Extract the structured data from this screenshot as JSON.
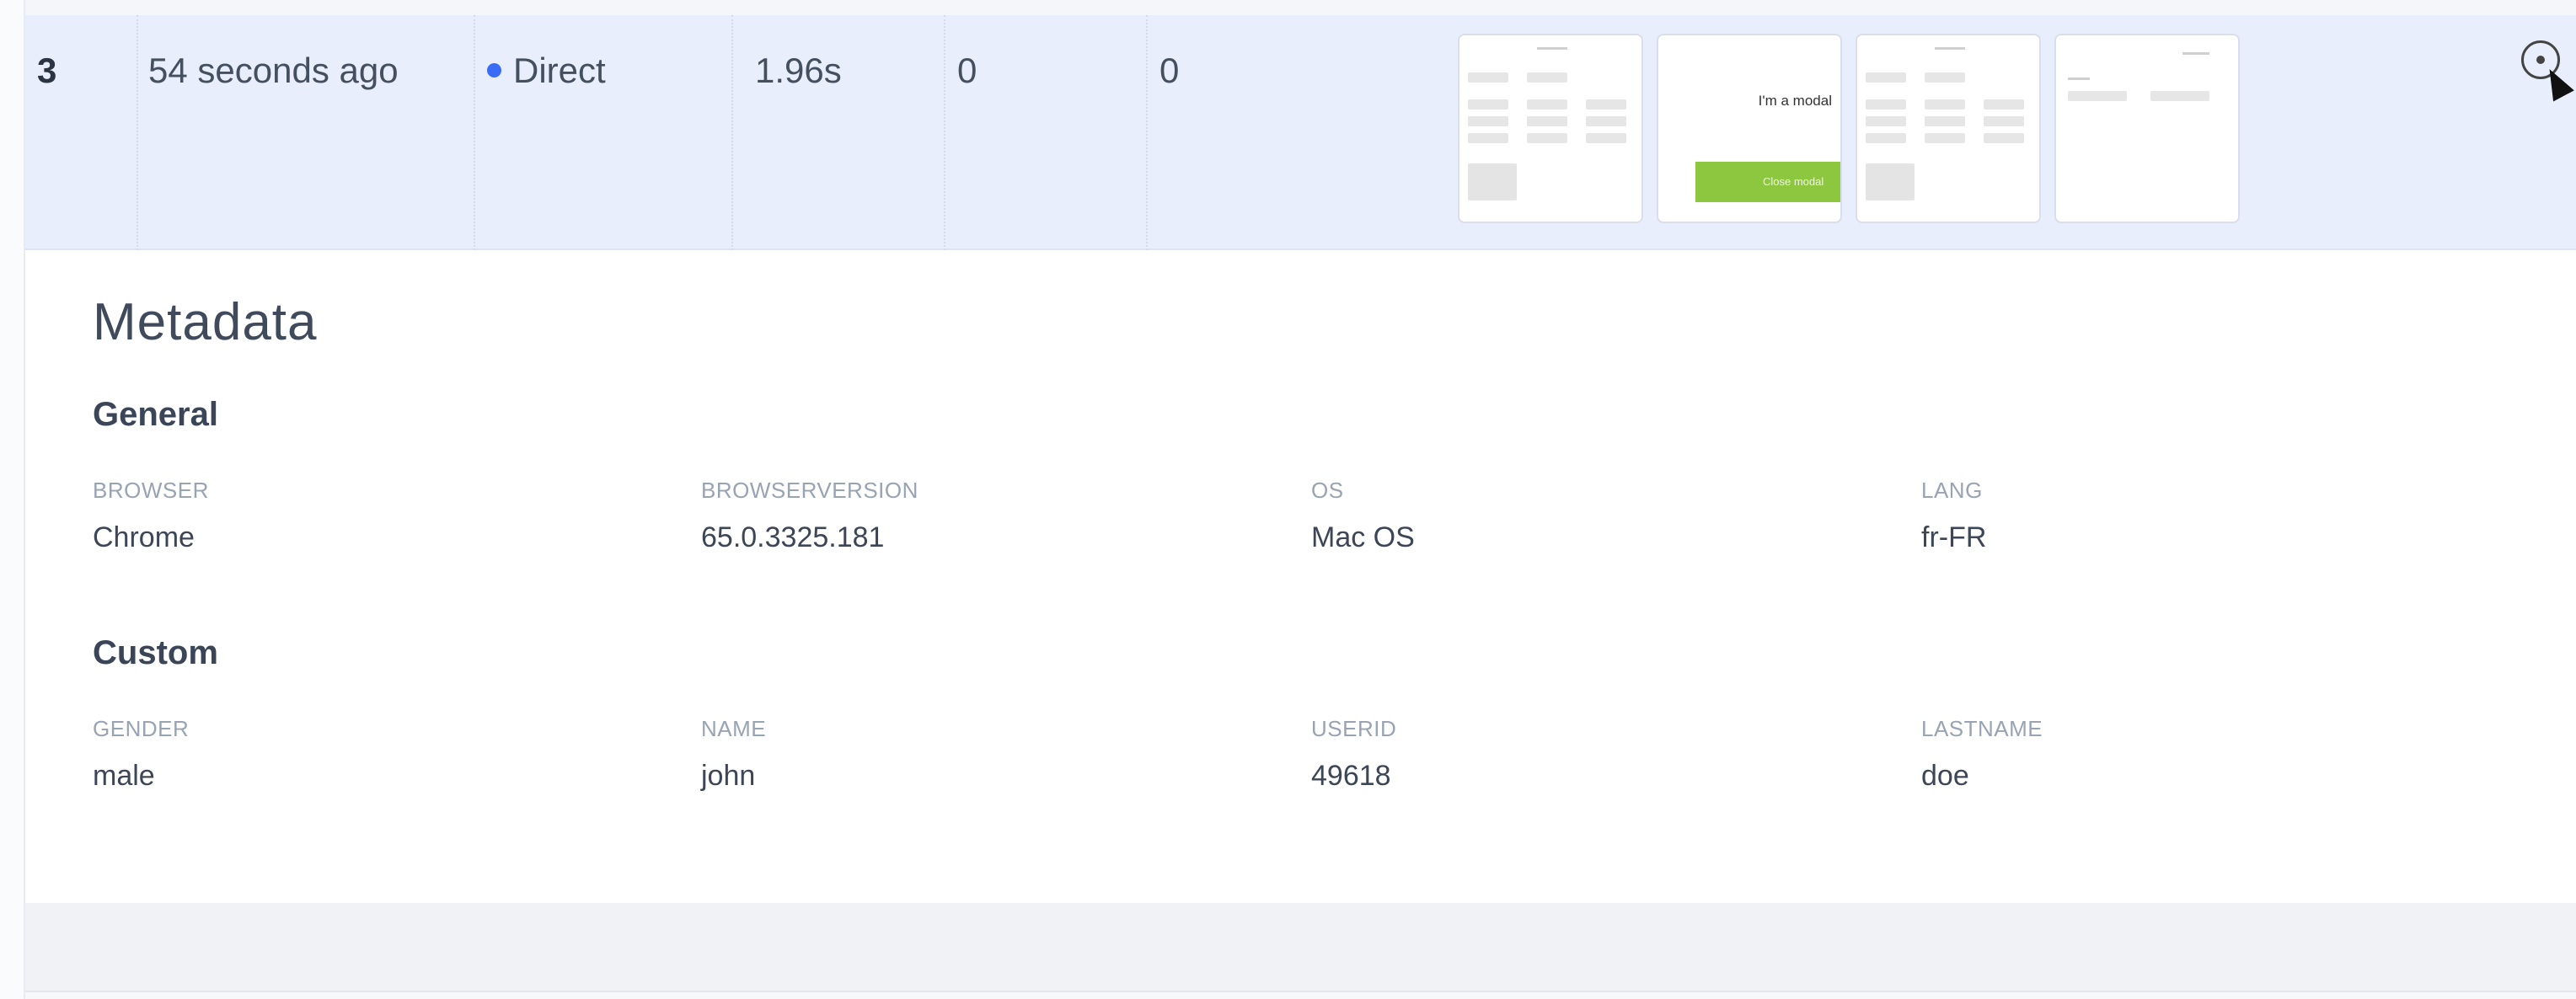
{
  "session": {
    "index": "3",
    "time": "54 seconds ago",
    "source": "Direct",
    "duration": "1.96s",
    "col_a": "0",
    "col_b": "0",
    "thumbnails": [
      {
        "kind": "form"
      },
      {
        "kind": "modal",
        "modal_text": "I'm a modal",
        "button_text": "Close modal"
      },
      {
        "kind": "form"
      },
      {
        "kind": "small"
      }
    ],
    "source_dot_color": "#3b6cf6"
  },
  "metadata": {
    "title": "Metadata",
    "general": {
      "title": "General",
      "fields": [
        {
          "key": "BROWSER",
          "value": "Chrome"
        },
        {
          "key": "BROWSERVERSION",
          "value": "65.0.3325.181"
        },
        {
          "key": "OS",
          "value": "Mac OS"
        },
        {
          "key": "LANG",
          "value": "fr-FR"
        }
      ]
    },
    "custom": {
      "title": "Custom",
      "fields": [
        {
          "key": "GENDER",
          "value": "male"
        },
        {
          "key": "NAME",
          "value": "john"
        },
        {
          "key": "USERID",
          "value": "49618"
        },
        {
          "key": "LASTNAME",
          "value": "doe"
        }
      ]
    }
  },
  "colors": {
    "row_bg": "#e9eefc",
    "accent_green": "#8dc63f"
  }
}
